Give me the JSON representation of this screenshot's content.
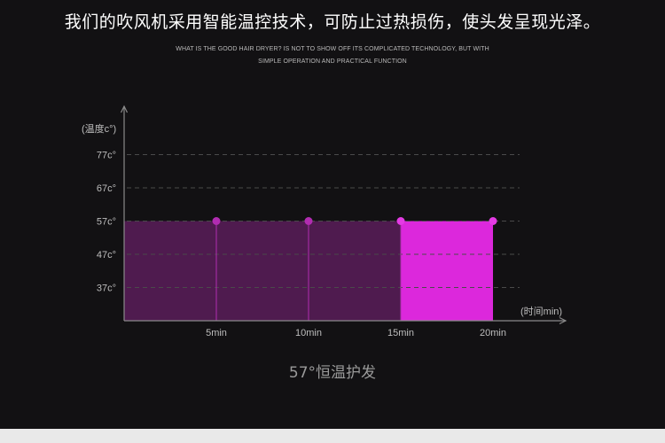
{
  "headline": "我们的吹风机采用智能温控技术，可防止过热损伤，使头发呈现光泽。",
  "subheadline": [
    "WHAT IS THE GOOD HAIR DRYER? IS NOT TO SHOW OFF ITS COMPLICATED TECHNOLOGY, BUT WITH",
    "SIMPLE OPERATION AND PRACTICAL FUNCTION"
  ],
  "caption": "57°恒温护发",
  "chart_data": {
    "type": "area",
    "ylabel": "(温度c°)",
    "xlabel": "(时间min)",
    "y_ticks": [
      {
        "value": 37,
        "label": "37c°"
      },
      {
        "value": 47,
        "label": "47c°"
      },
      {
        "value": 57,
        "label": "57c°"
      },
      {
        "value": 67,
        "label": "67c°"
      },
      {
        "value": 77,
        "label": "77c°"
      }
    ],
    "x_ticks": [
      {
        "value": 5,
        "label": "5min"
      },
      {
        "value": 10,
        "label": "10min"
      },
      {
        "value": 15,
        "label": "15min"
      },
      {
        "value": 20,
        "label": "20min"
      }
    ],
    "ylim": [
      27,
      80
    ],
    "xlim": [
      0,
      21
    ],
    "grid": true,
    "points": [
      {
        "x": 5,
        "y": 57
      },
      {
        "x": 10,
        "y": 57
      },
      {
        "x": 15,
        "y": 57
      },
      {
        "x": 20,
        "y": 57
      }
    ],
    "segments": [
      {
        "x0": 0,
        "x1": 15,
        "y": 57,
        "color": "#4f1b4f"
      },
      {
        "x0": 15,
        "x1": 20,
        "y": 57,
        "color": "#dc28dc"
      }
    ],
    "colors": {
      "axis": "#8a8a8a",
      "grid": "#4a4a4a",
      "point_dim": "#b12cb1",
      "point_bright": "#e43be4",
      "text": "#bdbdbd"
    }
  }
}
